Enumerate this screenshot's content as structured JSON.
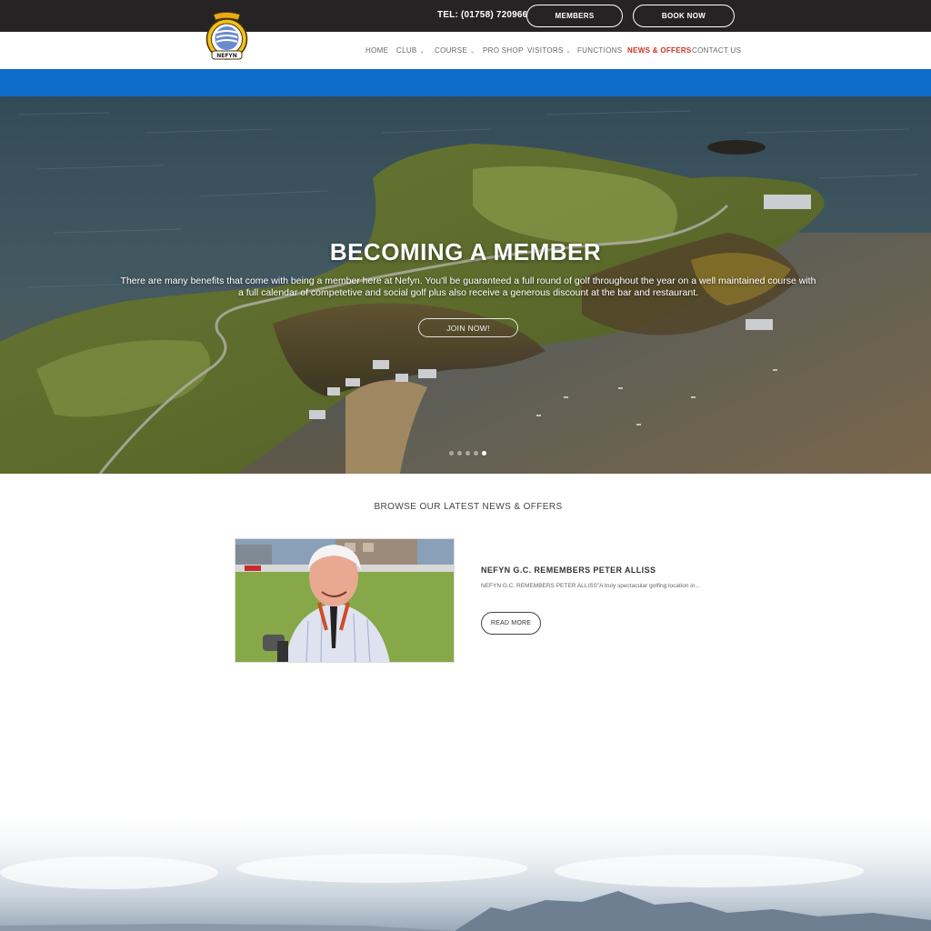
{
  "topbar": {
    "tel": "TEL: (01758) 720966",
    "members_label": "MEMBERS",
    "book_label": "BOOK NOW"
  },
  "header": {
    "logo_text": "NEFYN"
  },
  "nav": {
    "items": [
      {
        "label": "HOME",
        "has_dropdown": false
      },
      {
        "label": "CLUB",
        "has_dropdown": true
      },
      {
        "label": "COURSE",
        "has_dropdown": true
      },
      {
        "label": "PRO SHOP",
        "has_dropdown": false
      },
      {
        "label": "VISITORS",
        "has_dropdown": true
      },
      {
        "label": "FUNCTIONS",
        "has_dropdown": false
      },
      {
        "label": "NEWS & OFFERS",
        "has_dropdown": false,
        "active": true
      },
      {
        "label": "CONTACT US",
        "has_dropdown": false
      }
    ],
    "dropdown_icon": "chevron-down-icon"
  },
  "hero": {
    "title": "BECOMING A MEMBER",
    "text": "There are many benefits that come with being a member here at Nefyn. You'll be guaranteed a full round of golf throughout the year on a well maintained course with a full calendar of competetive and social golf plus also receive a generous discount at the bar and restaurant.",
    "button_label": "JOIN NOW!",
    "slide_count": 5,
    "active_slide": 5
  },
  "news": {
    "heading": "BROWSE OUR LATEST NEWS & OFFERS",
    "posts": [
      {
        "title": "NEFYN G.C. REMEMBERS PETER ALLISS",
        "excerpt": "NEFYN G.C. REMEMBERS PETER ALLISS\"A truly spectacular golfing location in...",
        "button_label": "READ MORE"
      }
    ]
  },
  "colors": {
    "topbar_bg": "#252324",
    "blue_strip": "#0e6ccb",
    "nav_active": "#c8321e"
  }
}
